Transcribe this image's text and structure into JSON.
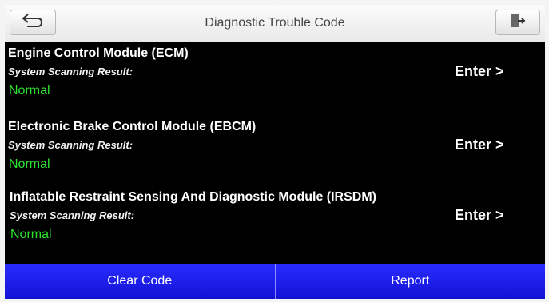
{
  "header": {
    "title": "Diagnostic Trouble Code",
    "back_icon": "back-arrow-icon",
    "exit_icon": "exit-door-icon"
  },
  "modules": [
    {
      "name": "Engine Control Module (ECM)",
      "scan_label": "System Scanning Result:",
      "status": "Normal",
      "action": "Enter >"
    },
    {
      "name": "Electronic Brake Control Module (EBCM)",
      "scan_label": "System Scanning Result:",
      "status": "Normal",
      "action": "Enter >"
    },
    {
      "name": "Inflatable Restraint Sensing And Diagnostic Module (IRSDM)",
      "scan_label": "System Scanning Result:",
      "status": "Normal",
      "action": "Enter >"
    }
  ],
  "footer": {
    "clear_label": "Clear Code",
    "report_label": "Report"
  },
  "colors": {
    "status_normal": "#2ee32e",
    "footer_button": "#1a1cf0",
    "background": "#000000"
  }
}
